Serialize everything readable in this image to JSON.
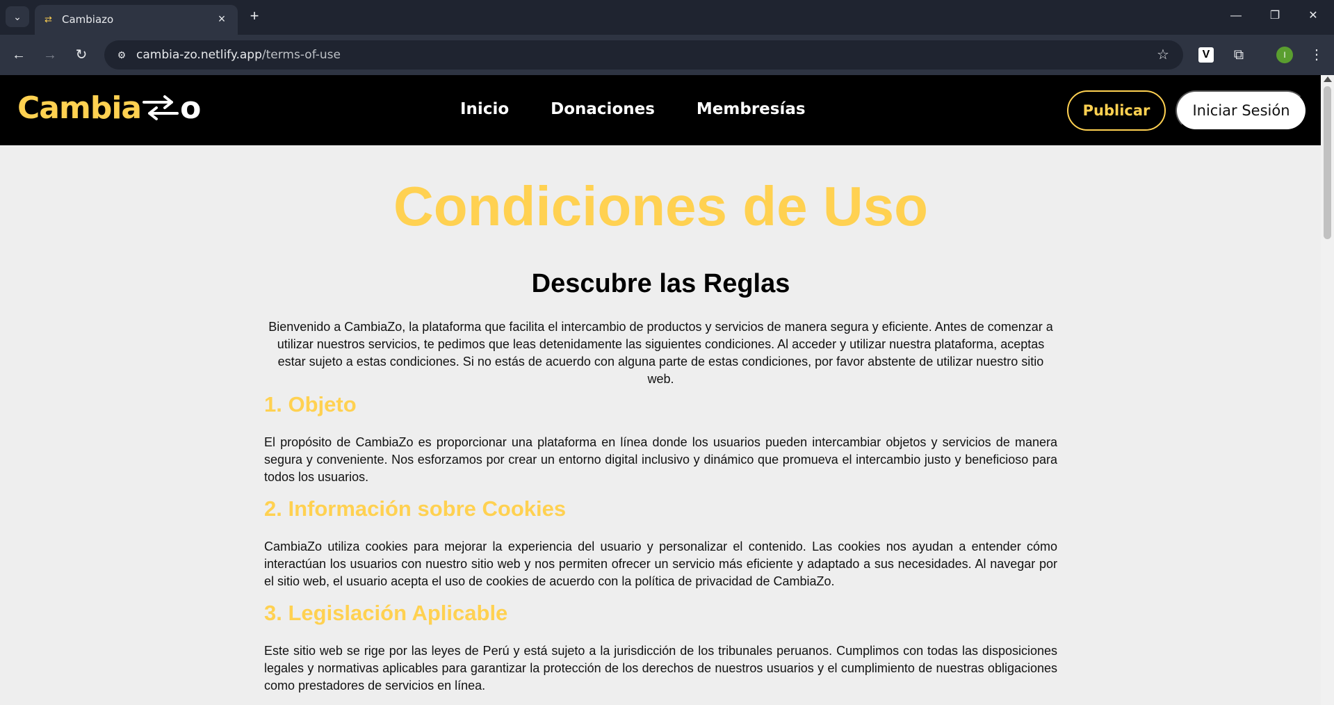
{
  "browser": {
    "tab_title": "Cambiazo",
    "url_domain": "cambia-zo.netlify.app",
    "url_path": "/terms-of-use",
    "profile_initial": "I",
    "extension_label": "V"
  },
  "site": {
    "logo_text": "Cambia",
    "logo_suffix": "o",
    "nav": [
      "Inicio",
      "Donaciones",
      "Membresías"
    ],
    "publish_label": "Publicar",
    "login_label": "Iniciar Sesión",
    "brand_color": "#ffd151"
  },
  "page": {
    "title": "Condiciones de Uso",
    "subtitle": "Descubre las Reglas",
    "intro": "Bienvenido a CambiaZo, la plataforma que facilita el intercambio de productos y servicios de manera segura y eficiente. Antes de comenzar a utilizar nuestros servicios, te pedimos que leas detenidamente las siguientes condiciones. Al acceder y utilizar nuestra plataforma, aceptas estar sujeto a estas condiciones. Si no estás de acuerdo con alguna parte de estas condiciones, por favor abstente de utilizar nuestro sitio web.",
    "sections": [
      {
        "heading": "1. Objeto",
        "body": "El propósito de CambiaZo es proporcionar una plataforma en línea donde los usuarios pueden intercambiar objetos y servicios de manera segura y conveniente. Nos esforzamos por crear un entorno digital inclusivo y dinámico que promueva el intercambio justo y beneficioso para todos los usuarios."
      },
      {
        "heading": "2. Información sobre Cookies",
        "body": "CambiaZo utiliza cookies para mejorar la experiencia del usuario y personalizar el contenido. Las cookies nos ayudan a entender cómo interactúan los usuarios con nuestro sitio web y nos permiten ofrecer un servicio más eficiente y adaptado a sus necesidades. Al navegar por el sitio web, el usuario acepta el uso de cookies de acuerdo con la política de privacidad de CambiaZo."
      },
      {
        "heading": "3. Legislación Aplicable",
        "body": "Este sitio web se rige por las leyes de Perú y está sujeto a la jurisdicción de los tribunales peruanos. Cumplimos con todas las disposiciones legales y normativas aplicables para garantizar la protección de los derechos de nuestros usuarios y el cumplimiento de nuestras obligaciones como prestadores de servicios en línea."
      }
    ]
  }
}
